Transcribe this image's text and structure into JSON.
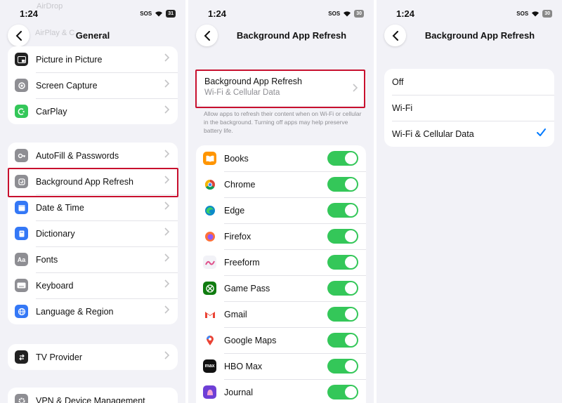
{
  "status": {
    "time": "1:24",
    "sos": "SOS",
    "battery1": "31",
    "battery2": "30",
    "battery3": "30"
  },
  "panel1": {
    "title": "General",
    "back_ghost": "AirPlay & C",
    "top_ghost": "AirDrop",
    "group1": [
      {
        "label": "Picture in Picture",
        "icon": "pip-icon"
      },
      {
        "label": "Screen Capture",
        "icon": "screen-capture-icon"
      },
      {
        "label": "CarPlay",
        "icon": "carplay-icon"
      }
    ],
    "group2": [
      {
        "label": "AutoFill & Passwords",
        "icon": "key-icon"
      },
      {
        "label": "Background App Refresh",
        "icon": "refresh-icon"
      },
      {
        "label": "Date & Time",
        "icon": "calendar-icon"
      },
      {
        "label": "Dictionary",
        "icon": "book-icon"
      },
      {
        "label": "Fonts",
        "icon": "fonts-icon",
        "glyph": "Aa"
      },
      {
        "label": "Keyboard",
        "icon": "keyboard-icon"
      },
      {
        "label": "Language & Region",
        "icon": "globe-icon"
      }
    ],
    "group3": [
      {
        "label": "TV Provider",
        "icon": "tv-provider-icon"
      }
    ],
    "group4": [
      {
        "label": "VPN & Device Management",
        "icon": "gear-icon"
      }
    ]
  },
  "panel2": {
    "title": "Background App Refresh",
    "setting_title": "Background App Refresh",
    "setting_value": "Wi-Fi & Cellular Data",
    "footnote": "Allow apps to refresh their content when on Wi-Fi or cellular in the background. Turning off apps may help preserve battery life.",
    "apps": [
      {
        "name": "Books",
        "icon": "books-icon",
        "color": "#ff9500"
      },
      {
        "name": "Chrome",
        "icon": "chrome-icon",
        "color": "#4285f4"
      },
      {
        "name": "Edge",
        "icon": "edge-icon",
        "color": "#0c8ac9"
      },
      {
        "name": "Firefox",
        "icon": "firefox-icon",
        "color": "#ff7139"
      },
      {
        "name": "Freeform",
        "icon": "freeform-icon",
        "color": "#e8e8ee"
      },
      {
        "name": "Game Pass",
        "icon": "xbox-icon",
        "color": "#107c10"
      },
      {
        "name": "Gmail",
        "icon": "gmail-icon",
        "color": "#ffffff"
      },
      {
        "name": "Google Maps",
        "icon": "maps-pin-icon",
        "color": "#ffffff"
      },
      {
        "name": "HBO Max",
        "icon": "hbo-max-icon",
        "color": "#111111",
        "glyph": "max"
      },
      {
        "name": "Journal",
        "icon": "journal-icon",
        "color": "#6e3fd6"
      }
    ]
  },
  "panel3": {
    "title": "Background App Refresh",
    "options": [
      {
        "label": "Off",
        "selected": false
      },
      {
        "label": "Wi-Fi",
        "selected": false
      },
      {
        "label": "Wi-Fi & Cellular Data",
        "selected": true
      }
    ]
  }
}
